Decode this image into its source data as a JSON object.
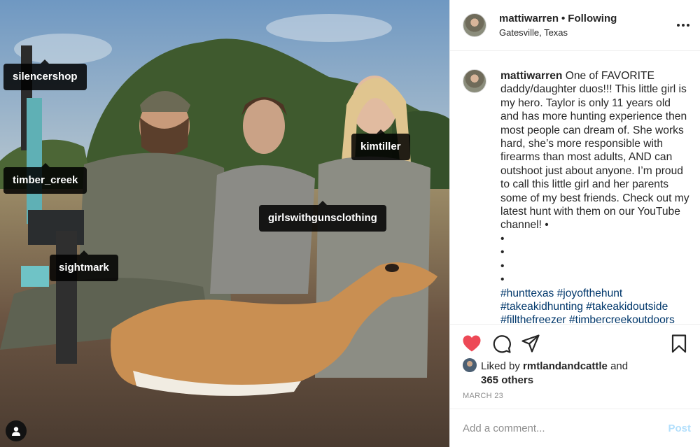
{
  "photo": {
    "tags": [
      {
        "label": "silencershop"
      },
      {
        "label": "timber_creek"
      },
      {
        "label": "kimtiller"
      },
      {
        "label": "girlswithgunsclothing"
      },
      {
        "label": "sightmark"
      }
    ]
  },
  "header": {
    "username": "mattiwarren",
    "separator": "•",
    "follow_status": "Following",
    "location": "Gatesville, Texas"
  },
  "caption": {
    "username": "mattiwarren",
    "text": "One of FAVORITE daddy/daughter duos!!! This little girl is my hero. Taylor is only 11 years old and has more hunting experience then most people can dream of. She works hard, she’s more responsible with firearms than most adults, AND can outshoot just about anyone. I’m proud to call this little girl and her parents some of my best friends. Check out my latest hunt with them on our YouTube channel! •",
    "bullets": [
      "•",
      "•",
      "•",
      "•"
    ],
    "hashtags": "#hunttexas #joyofthehunt #takeakidhunting #takeakidoutside #fillthefreezer #timbercreekoutdoors"
  },
  "actions": {
    "like_icon": "heart-filled-icon",
    "comment_icon": "comment-icon",
    "share_icon": "paper-plane-icon",
    "save_icon": "bookmark-icon",
    "heart_color": "#ed4956"
  },
  "likes": {
    "prefix": "Liked by",
    "user": "rmtlandandcattle",
    "conj": "and",
    "others": "365 others"
  },
  "date": "MARCH 23",
  "comment": {
    "placeholder": "Add a comment...",
    "post_label": "Post"
  }
}
